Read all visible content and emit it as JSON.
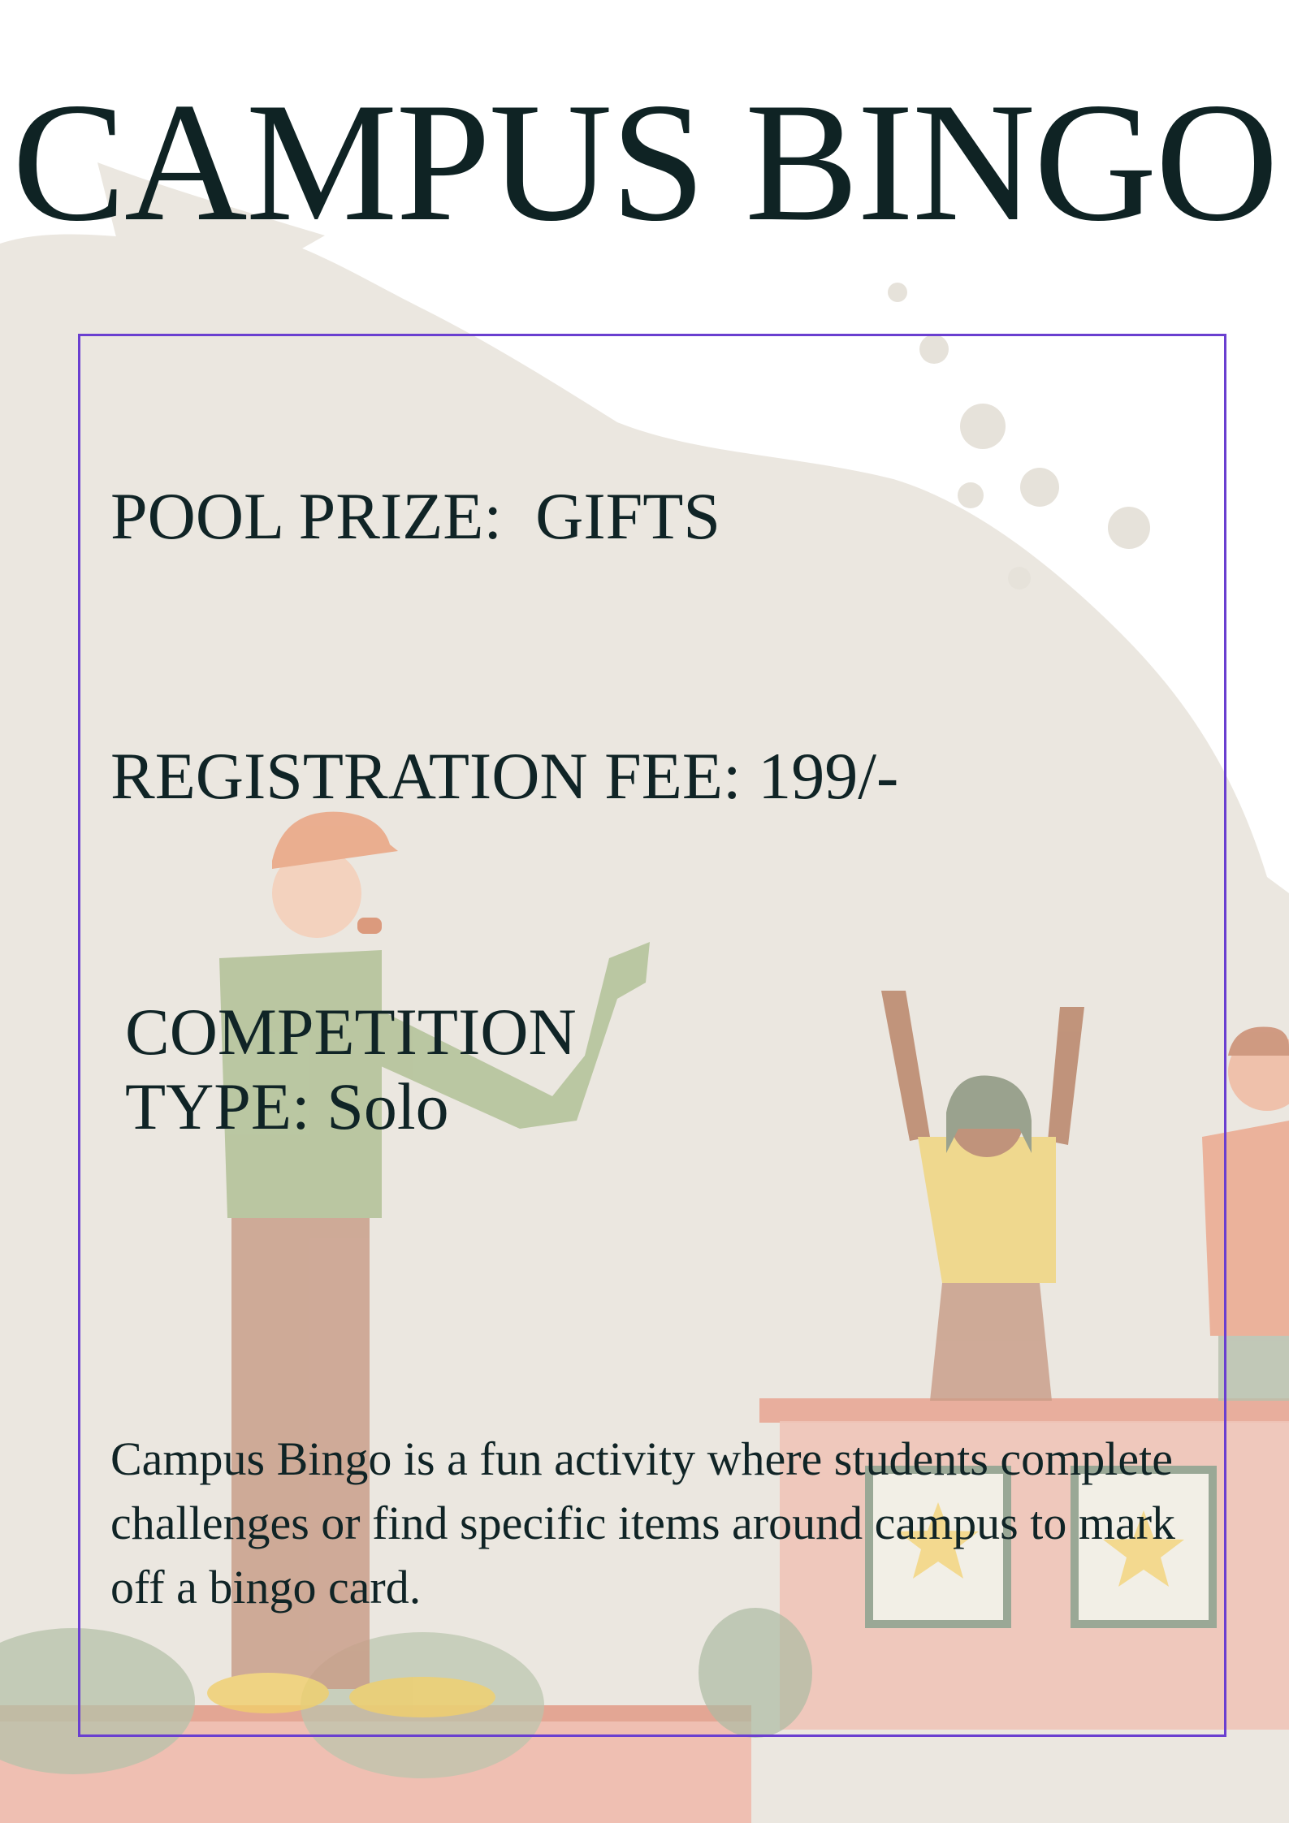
{
  "title": "CAMPUS BINGO",
  "details": {
    "pool_prize": "POOL PRIZE:  GIFTS",
    "registration_fee": "REGISTRATION FEE: 199/-",
    "competition_type": "COMPETITION\nTYPE: Solo"
  },
  "description": "Campus Bingo is a fun activity where students complete challenges or find specific items around campus to mark off a bingo card.",
  "colors": {
    "title_text": "#0f2324",
    "body_text": "#102426",
    "frame_border": "#6a3fd0",
    "backdrop": "#e9e6df"
  }
}
